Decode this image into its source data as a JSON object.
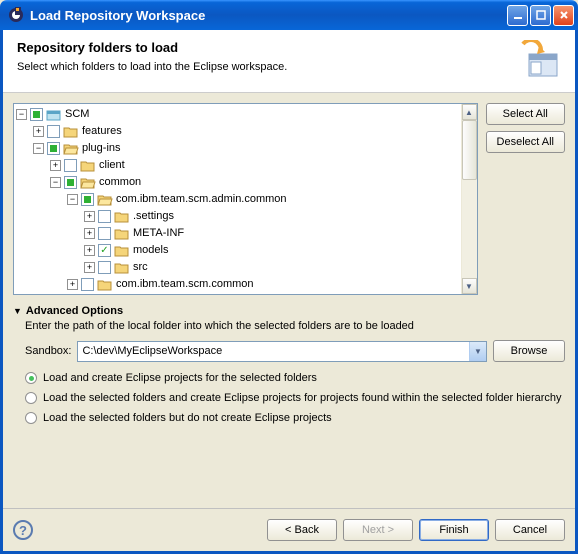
{
  "window": {
    "title": "Load Repository Workspace"
  },
  "header": {
    "title": "Repository folders to load",
    "subtitle": "Select which folders to load into the Eclipse workspace."
  },
  "tree": {
    "nodes": [
      {
        "depth": 0,
        "exp": "minus",
        "check": "mixed",
        "icon": "ws",
        "label": "SCM"
      },
      {
        "depth": 1,
        "exp": "plus",
        "check": "empty",
        "icon": "folder",
        "label": "features"
      },
      {
        "depth": 1,
        "exp": "minus",
        "check": "mixed",
        "icon": "folder-open",
        "label": "plug-ins"
      },
      {
        "depth": 2,
        "exp": "plus",
        "check": "empty",
        "icon": "folder",
        "label": "client"
      },
      {
        "depth": 2,
        "exp": "minus",
        "check": "mixed",
        "icon": "folder-open",
        "label": "common"
      },
      {
        "depth": 3,
        "exp": "minus",
        "check": "mixed",
        "icon": "folder-open",
        "label": "com.ibm.team.scm.admin.common"
      },
      {
        "depth": 4,
        "exp": "plus",
        "check": "empty",
        "icon": "folder",
        "label": ".settings"
      },
      {
        "depth": 4,
        "exp": "plus",
        "check": "empty",
        "icon": "folder",
        "label": "META-INF"
      },
      {
        "depth": 4,
        "exp": "plus",
        "check": "checked",
        "icon": "folder",
        "label": "models"
      },
      {
        "depth": 4,
        "exp": "plus",
        "check": "empty",
        "icon": "folder",
        "label": "src"
      },
      {
        "depth": 3,
        "exp": "plus",
        "check": "empty",
        "icon": "folder",
        "label": "com.ibm.team.scm.common"
      }
    ]
  },
  "buttons": {
    "select_all": "Select All",
    "deselect_all": "Deselect All",
    "browse": "Browse",
    "back": "< Back",
    "next": "Next >",
    "finish": "Finish",
    "cancel": "Cancel"
  },
  "advanced": {
    "title": "Advanced Options",
    "desc": "Enter the path of the local folder into which the selected folders are to be loaded",
    "sandbox_label": "Sandbox:",
    "sandbox_value": "C:\\dev\\MyEclipseWorkspace",
    "options": [
      "Load and create Eclipse projects for the selected folders",
      "Load the selected folders and create Eclipse projects for projects found within the selected folder hierarchy",
      "Load the selected folders but do not create Eclipse projects"
    ],
    "selected": 0
  }
}
